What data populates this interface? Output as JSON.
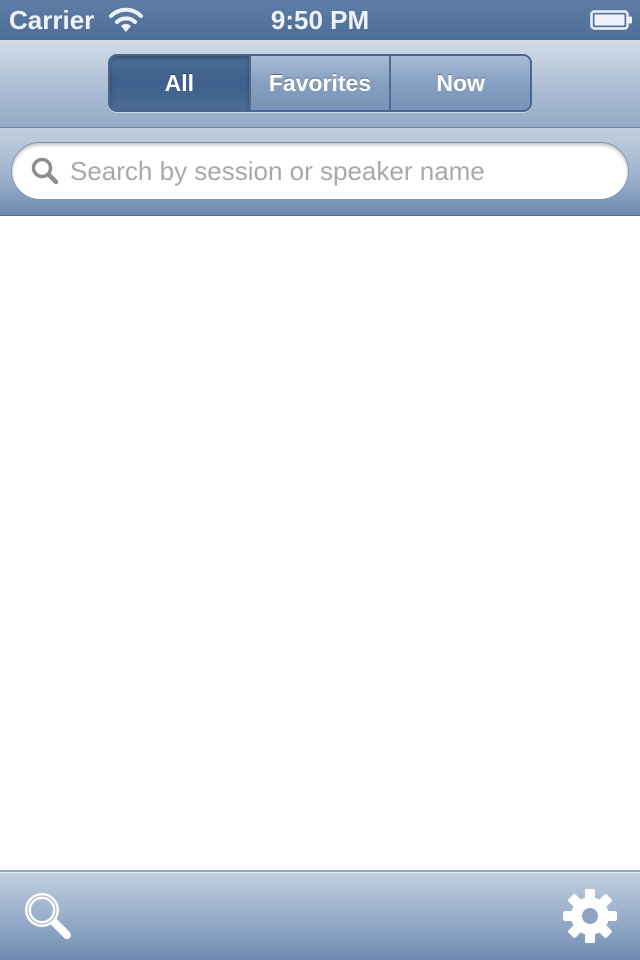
{
  "status_bar": {
    "carrier": "Carrier",
    "time": "9:50 PM",
    "wifi_icon": "wifi-icon",
    "battery_icon": "battery-icon"
  },
  "segments": [
    {
      "label": "All",
      "selected": true
    },
    {
      "label": "Favorites",
      "selected": false
    },
    {
      "label": "Now",
      "selected": false
    }
  ],
  "search": {
    "placeholder": "Search by session or speaker name",
    "value": "",
    "icon": "magnifier-icon"
  },
  "toolbar": {
    "left_icon": "search-icon",
    "right_icon": "gear-icon"
  },
  "colors": {
    "status_bar": "#4c6d98",
    "nav_accent": "#4a6690",
    "selected_segment": "#3f5f8c",
    "placeholder": "#a9a9a9"
  }
}
